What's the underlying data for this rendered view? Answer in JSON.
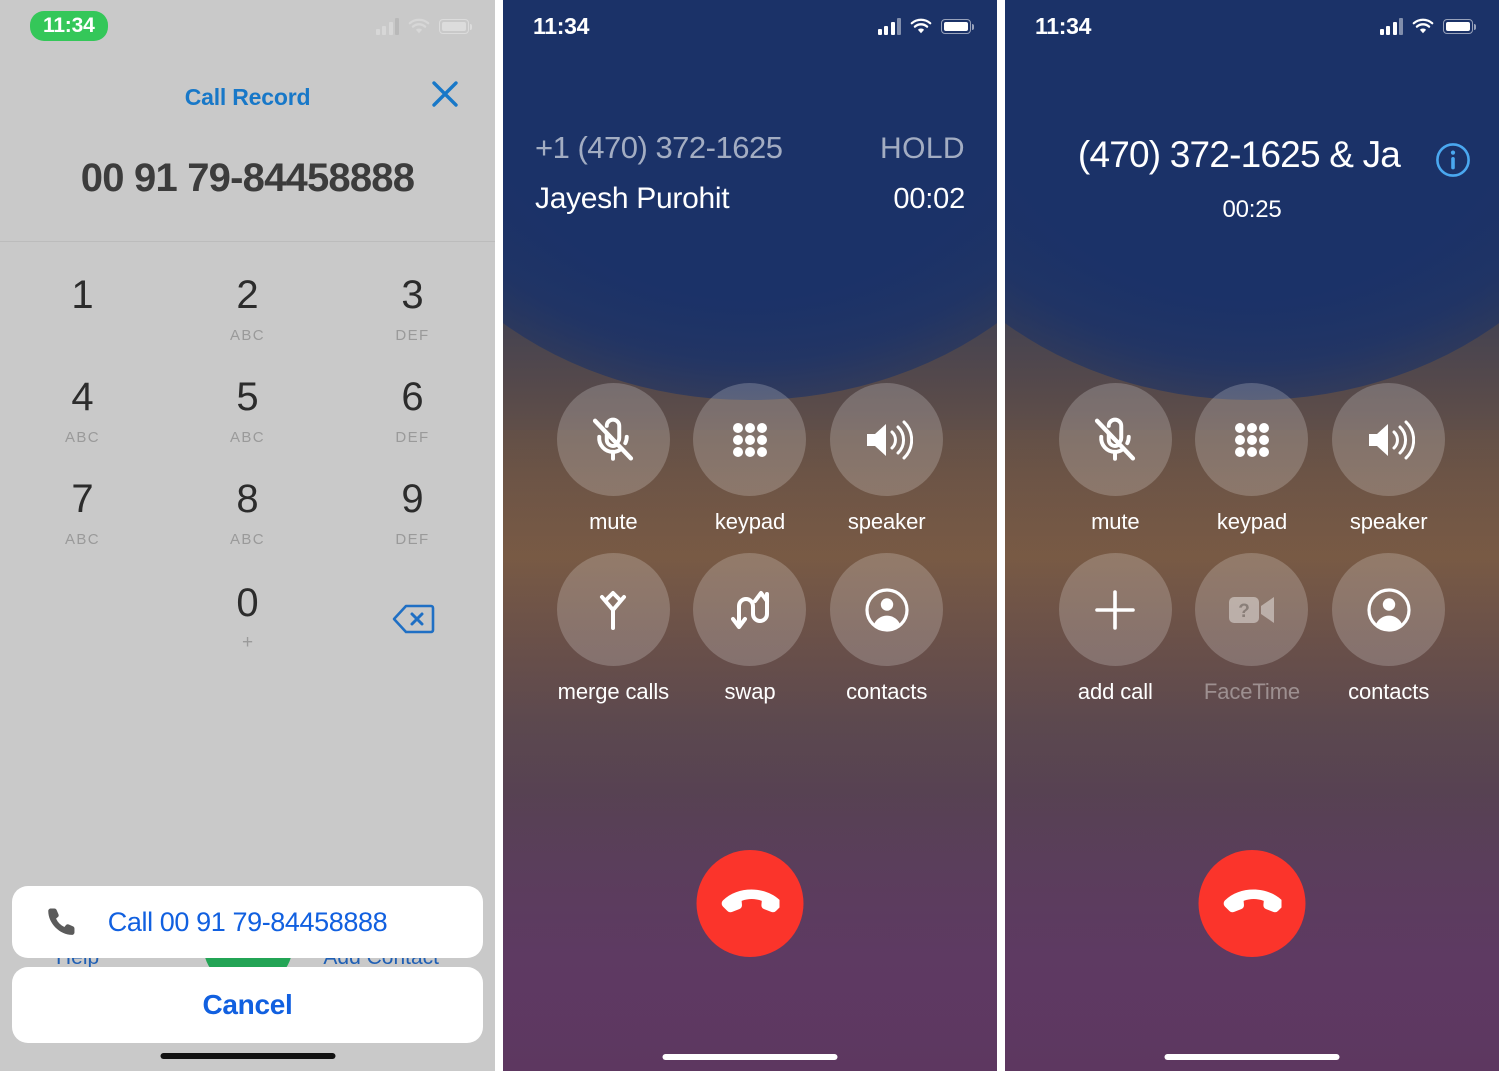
{
  "screens": [
    {
      "id": "dialer",
      "statusbar": {
        "time": "11:34",
        "time_style": "green-pill",
        "icons": [
          "cellular-icon",
          "wifi-icon",
          "battery-icon"
        ]
      },
      "sheet": {
        "title": "Call Record",
        "close_icon": "close-icon",
        "number": "00 91 79-84458888"
      },
      "keypad": [
        {
          "digit": "1",
          "letters": ""
        },
        {
          "digit": "2",
          "letters": "ABC"
        },
        {
          "digit": "3",
          "letters": "DEF"
        },
        {
          "digit": "4",
          "letters": "ABC"
        },
        {
          "digit": "5",
          "letters": "ABC"
        },
        {
          "digit": "6",
          "letters": "DEF"
        },
        {
          "digit": "7",
          "letters": "ABC"
        },
        {
          "digit": "8",
          "letters": "ABC"
        },
        {
          "digit": "9",
          "letters": "DEF"
        },
        {
          "digit": "",
          "letters": ""
        },
        {
          "digit": "0",
          "letters": "+"
        },
        {
          "digit": "",
          "letters": "",
          "icon": "backspace-icon"
        }
      ],
      "underlay": {
        "help_label": "Help",
        "add_contact_label": "Add Contact",
        "call_button_icon": "phone-call-icon",
        "call_button_color": "#23a455"
      },
      "actions": {
        "call_label": "Call 00 91 79-84458888",
        "call_icon": "phone-handset-icon",
        "cancel_label": "Cancel"
      },
      "accent": "#1160e0",
      "title_color": "#1878c8"
    },
    {
      "id": "active-call",
      "statusbar": {
        "time": "11:34",
        "time_style": "plain",
        "icons": [
          "cellular-icon",
          "wifi-icon",
          "battery-icon"
        ]
      },
      "header": {
        "held_number": "+1 (470) 372-1625",
        "held_status": "HOLD",
        "active_name": "Jayesh Purohit",
        "active_timer": "00:02"
      },
      "controls": [
        {
          "label": "mute",
          "icon": "mic-off-icon",
          "disabled": false
        },
        {
          "label": "keypad",
          "icon": "keypad-dots-icon",
          "disabled": false
        },
        {
          "label": "speaker",
          "icon": "speaker-icon",
          "disabled": false
        },
        {
          "label": "merge calls",
          "icon": "merge-calls-icon",
          "disabled": false
        },
        {
          "label": "swap",
          "icon": "swap-icon",
          "disabled": false
        },
        {
          "label": "contacts",
          "icon": "contacts-person-icon",
          "disabled": false
        }
      ],
      "end_call": {
        "icon": "end-call-icon",
        "color": "#fb342b"
      }
    },
    {
      "id": "merged-call",
      "statusbar": {
        "time": "11:34",
        "time_style": "plain",
        "icons": [
          "cellular-icon",
          "wifi-icon",
          "battery-icon"
        ]
      },
      "header": {
        "title": "(470) 372-1625 & Ja",
        "info_icon": "info-circle-icon",
        "timer": "00:25"
      },
      "controls": [
        {
          "label": "mute",
          "icon": "mic-off-icon",
          "disabled": false
        },
        {
          "label": "keypad",
          "icon": "keypad-dots-icon",
          "disabled": false
        },
        {
          "label": "speaker",
          "icon": "speaker-icon",
          "disabled": false
        },
        {
          "label": "add call",
          "icon": "plus-icon",
          "disabled": false
        },
        {
          "label": "FaceTime",
          "icon": "facetime-video-icon",
          "disabled": true
        },
        {
          "label": "contacts",
          "icon": "contacts-person-icon",
          "disabled": false
        }
      ],
      "end_call": {
        "icon": "end-call-icon",
        "color": "#fb342b"
      }
    }
  ]
}
